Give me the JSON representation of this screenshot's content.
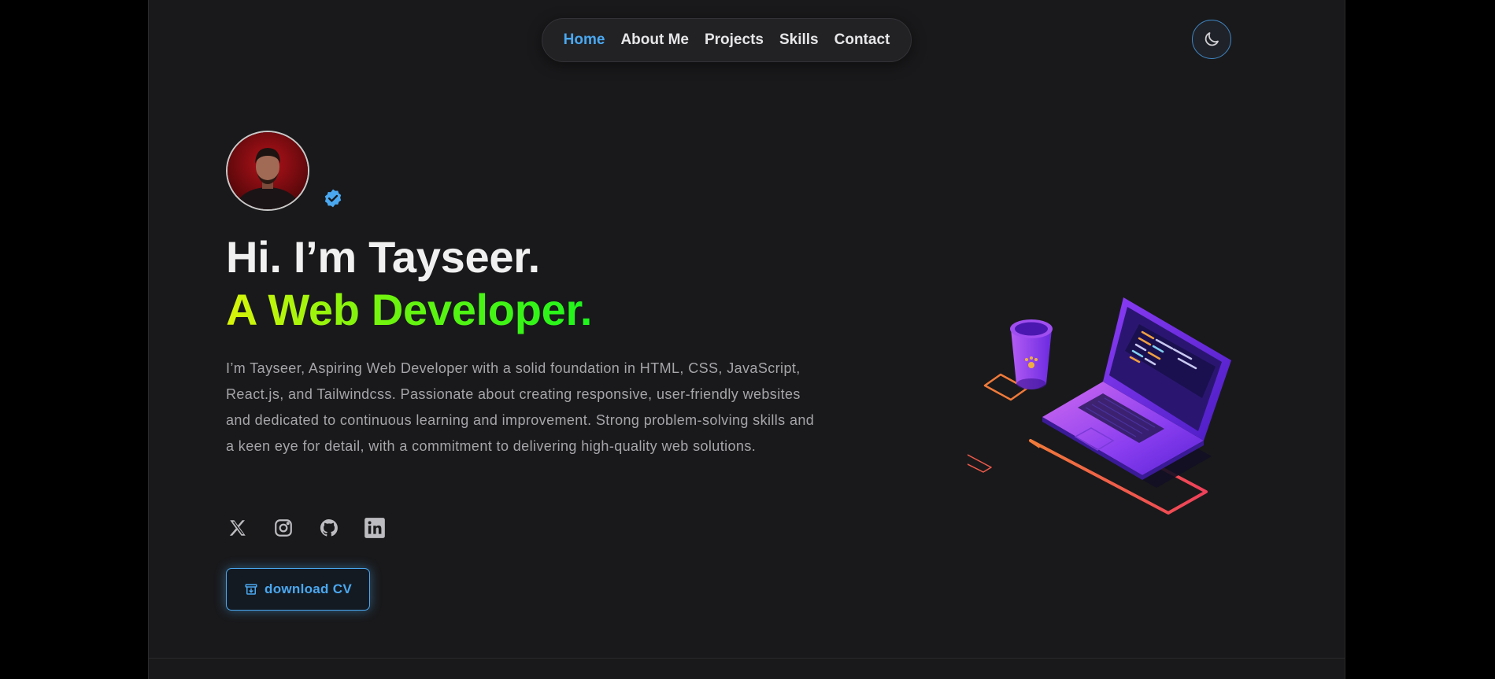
{
  "nav": {
    "items": [
      {
        "label": "Home",
        "active": true
      },
      {
        "label": "About Me",
        "active": false
      },
      {
        "label": "Projects",
        "active": false
      },
      {
        "label": "Skills",
        "active": false
      },
      {
        "label": "Contact",
        "active": false
      }
    ],
    "accent_color": "#4aa8f0"
  },
  "theme_toggle": {
    "icon": "moon-icon"
  },
  "hero": {
    "avatar_icon": "avatar",
    "verified_icon": "verified-badge-icon",
    "greeting": "Hi. I’m Tayseer.",
    "role": "A Web Developer.",
    "role_gradient": [
      "#d9f50a",
      "#1df51c"
    ],
    "bio": "I’m Tayseer, Aspiring Web Developer with a solid foundation in HTML, CSS, JavaScript, React.js, and Tailwindcss. Passionate about creating responsive, user-friendly websites and dedicated to continuous learning and improvement. Strong problem-solving skills and a keen eye for detail, with a commitment to delivering high-quality web solutions.",
    "socials": [
      "x-icon",
      "instagram-icon",
      "github-icon",
      "linkedin-icon"
    ],
    "cta_label": "download CV",
    "cta_icon": "archive-download-icon"
  },
  "illustration": "laptop-and-coffee-cup-illustration"
}
